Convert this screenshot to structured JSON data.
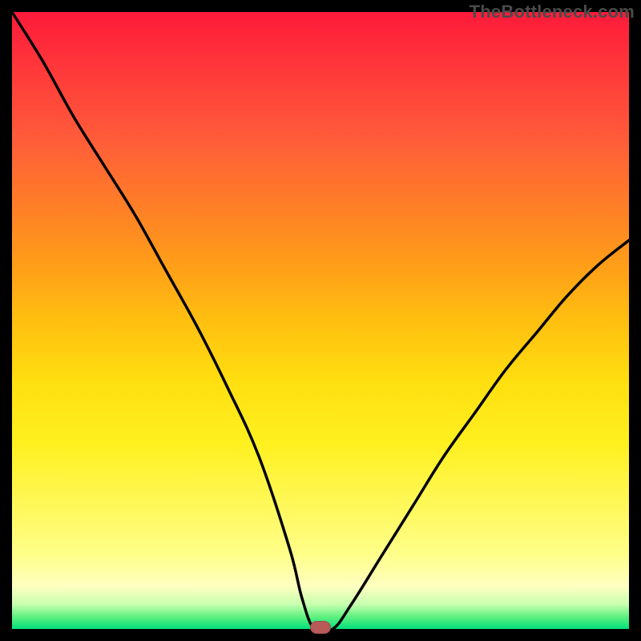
{
  "watermark": "TheBottleneck.com",
  "chart_data": {
    "type": "line",
    "title": "",
    "xlabel": "",
    "ylabel": "",
    "xlim": [
      0,
      100
    ],
    "ylim": [
      0,
      100
    ],
    "grid": false,
    "legend": false,
    "background_gradient": {
      "top": "#ff1a3a",
      "mid": "#ffdf10",
      "bottom": "#00e07a"
    },
    "series": [
      {
        "name": "bottleneck-curve",
        "color": "#000000",
        "x": [
          0,
          5,
          10,
          15,
          20,
          25,
          30,
          35,
          40,
          45,
          47,
          49,
          52,
          55,
          60,
          65,
          70,
          75,
          80,
          85,
          90,
          95,
          100
        ],
        "values": [
          100,
          92,
          83,
          75,
          67,
          58,
          49,
          39,
          28,
          13,
          5,
          0,
          0,
          4,
          12,
          20,
          28,
          35,
          42,
          48,
          54,
          59,
          63
        ]
      }
    ],
    "marker": {
      "x": 50,
      "y": 0,
      "color": "#b85a5a"
    }
  }
}
